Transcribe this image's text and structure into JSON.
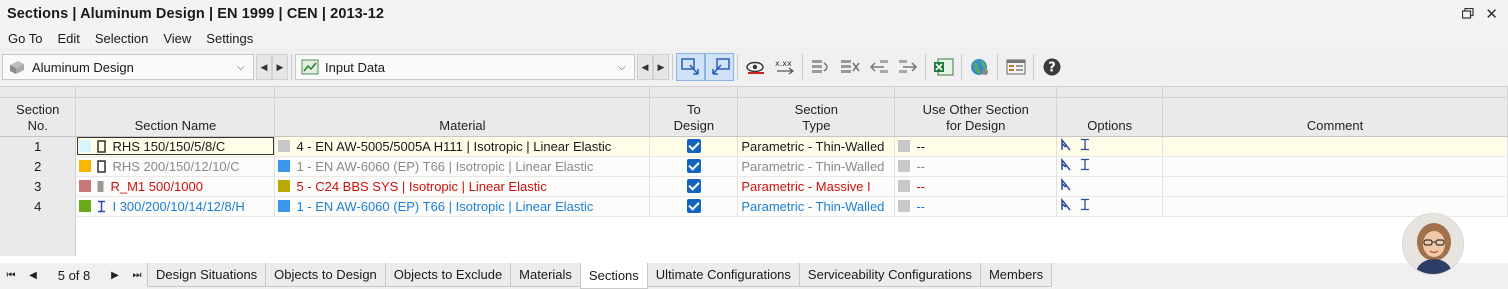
{
  "window": {
    "title": "Sections | Aluminum Design | EN 1999 | CEN | 2013-12"
  },
  "menu": [
    "Go To",
    "Edit",
    "Selection",
    "View",
    "Settings"
  ],
  "toolbar": {
    "module_combo": "Aluminum Design",
    "table_combo": "Input Data"
  },
  "table": {
    "headers": {
      "section_no": "Section\nNo.",
      "section_name": "Section Name",
      "material": "Material",
      "to_design": "To\nDesign",
      "section_type": "Section\nType",
      "use_other": "Use Other Section\nfor Design",
      "options": "Options",
      "comment": "Comment"
    },
    "rows": [
      {
        "no": "1",
        "name": "RHS 150/150/5/8/C",
        "name_color": "#1a1a1a",
        "swatch": "#d6f6fb",
        "shape": "rect",
        "material": "4 - EN AW-5005/5005A H111 | Isotropic | Linear Elastic",
        "mat_color": "#1a1a1a",
        "mat_swatch": "#c8c8c8",
        "to_design": true,
        "type": "Parametric - Thin-Walled",
        "type_color": "#1a1a1a",
        "use_other": "--",
        "use_other_color": "#1a1a1a",
        "options": [
          "taper-icon",
          "i-beam-icon"
        ],
        "comment": ""
      },
      {
        "no": "2",
        "name": "RHS 200/150/12/10/C",
        "name_color": "#8a8a8a",
        "swatch": "#f5b800",
        "shape": "rect",
        "material": "1 - EN AW-6060 (EP) T66 | Isotropic | Linear Elastic",
        "mat_color": "#8a8a8a",
        "mat_swatch": "#3a96e8",
        "to_design": true,
        "type": "Parametric - Thin-Walled",
        "type_color": "#8a8a8a",
        "use_other": "--",
        "use_other_color": "#8a8a8a",
        "options": [
          "taper-icon",
          "i-beam-icon"
        ],
        "comment": ""
      },
      {
        "no": "3",
        "name": "R_M1 500/1000",
        "name_color": "#cc1111",
        "swatch": "#c87878",
        "shape": "solid",
        "material": "5 - C24 BBS SYS | Isotropic | Linear Elastic",
        "mat_color": "#cc1111",
        "mat_swatch": "#b8a800",
        "to_design": true,
        "type": "Parametric - Massive I",
        "type_color": "#cc1111",
        "use_other": "--",
        "use_other_color": "#cc1111",
        "options": [
          "taper-icon"
        ],
        "comment": ""
      },
      {
        "no": "4",
        "name": "I 300/200/10/14/12/8/H",
        "name_color": "#1c7fd6",
        "swatch": "#6aaa1a",
        "shape": "ibeam",
        "material": "1 - EN AW-6060 (EP) T66 | Isotropic | Linear Elastic",
        "mat_color": "#1c7fd6",
        "mat_swatch": "#3a96e8",
        "to_design": true,
        "type": "Parametric - Thin-Walled",
        "type_color": "#1c7fd6",
        "use_other": "--",
        "use_other_color": "#1c7fd6",
        "options": [
          "taper-icon",
          "i-beam-icon"
        ],
        "comment": ""
      }
    ]
  },
  "pager": {
    "info": "5 of 8"
  },
  "tabs": [
    "Design Situations",
    "Objects to Design",
    "Objects to Exclude",
    "Materials",
    "Sections",
    "Ultimate Configurations",
    "Serviceability Configurations",
    "Members"
  ],
  "active_tab": "Sections"
}
